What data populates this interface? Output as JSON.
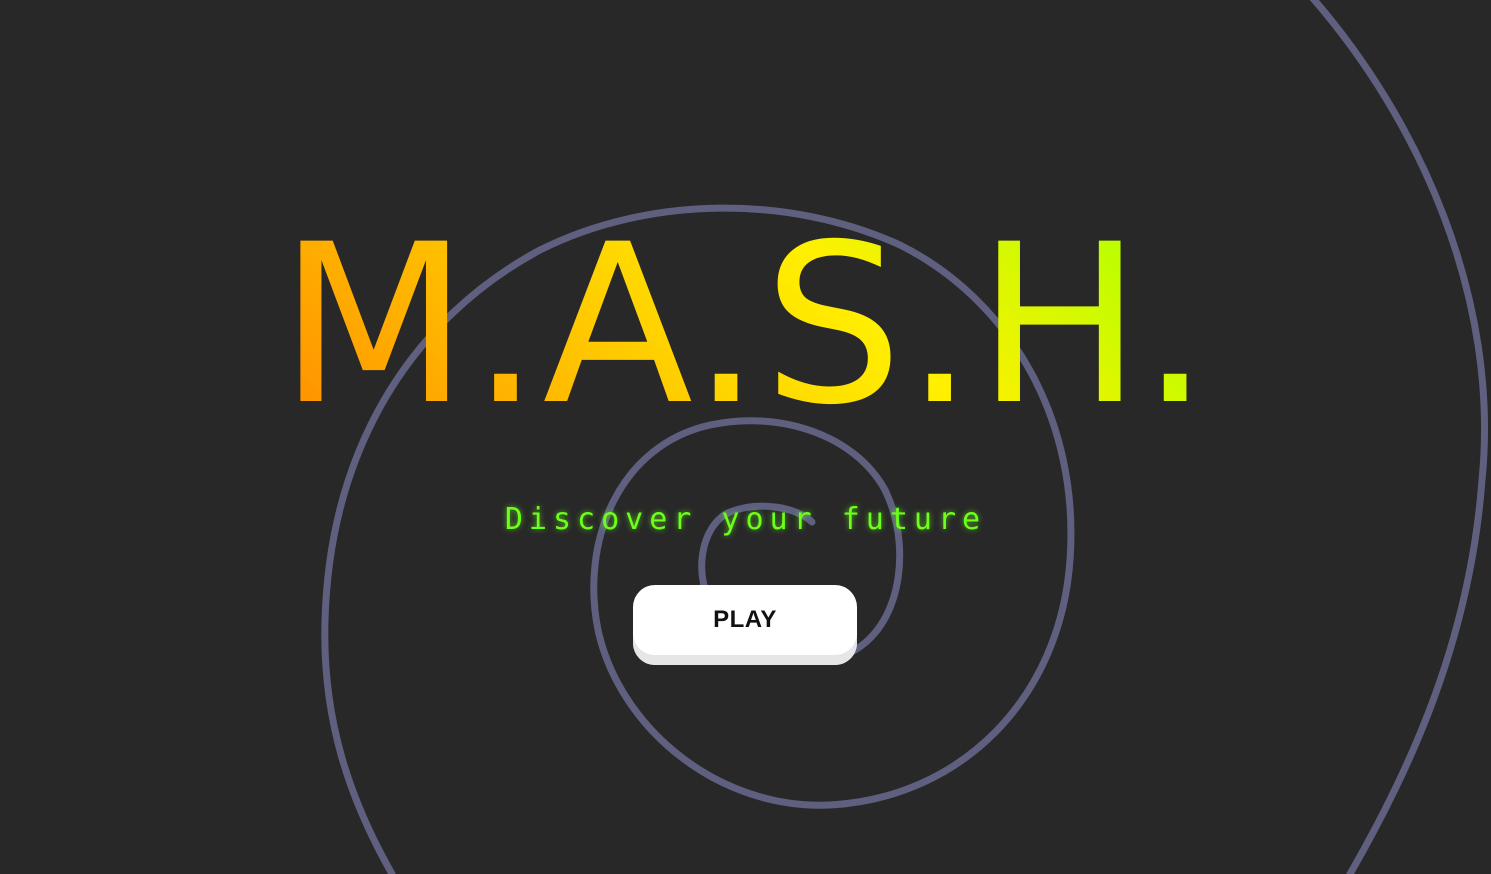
{
  "title": "M.A.S.H.",
  "tagline": "Discover your future",
  "play_button": {
    "label": "PLAY"
  },
  "colors": {
    "background": "#282828",
    "spiral": "#5f5f80",
    "title_gradient": [
      "#ff5a00",
      "#ff9a00",
      "#ffd400",
      "#fff000",
      "#b6ff00",
      "#5cff00"
    ],
    "tagline": "#6cff1a",
    "button_bg": "#ffffff",
    "button_text": "#111111"
  }
}
